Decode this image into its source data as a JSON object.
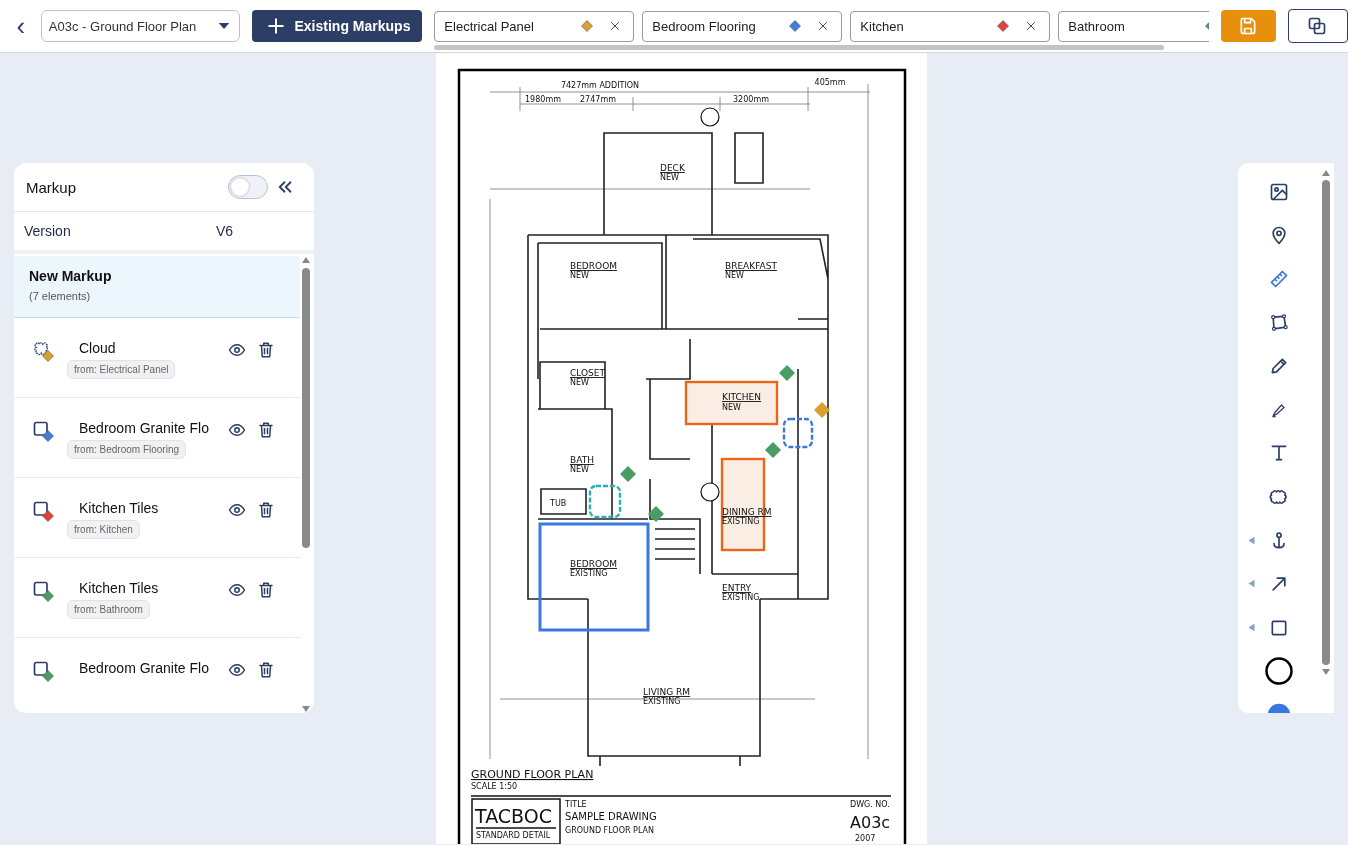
{
  "topbar": {
    "back": "‹",
    "sheet": {
      "value": "A03c - Ground Floor Plan"
    },
    "existing_button": "Existing Markups",
    "tabs": [
      {
        "label": "Electrical Panel",
        "color": "#d9a12b"
      },
      {
        "label": "Bedroom Flooring",
        "color": "#3f7fd6"
      },
      {
        "label": "Kitchen",
        "color": "#e0413a"
      },
      {
        "label": "Bathroom",
        "color": "#4a9d62"
      }
    ]
  },
  "panel": {
    "title": "Markup",
    "toggle": {
      "on": false
    },
    "version_label": "Version",
    "version": "V6",
    "group": {
      "title": "New Markup",
      "count": "(7 elements)",
      "selected": true
    },
    "items": [
      {
        "name": "Cloud",
        "source": "from: Electrical Panel",
        "kind": "cloud",
        "color": "#d9a12b"
      },
      {
        "name": "Bedroom Granite Flo",
        "source": "from: Bedroom Flooring",
        "kind": "rect",
        "color": "#3f7fd6"
      },
      {
        "name": "Kitchen Tiles",
        "source": "from: Kitchen",
        "kind": "rect",
        "color": "#e0413a"
      },
      {
        "name": "Kitchen Tiles",
        "source": "from: Bathroom",
        "kind": "rect",
        "color": "#4a9d62"
      },
      {
        "name": "Bedroom Granite Flo",
        "kind": "rect",
        "color": "#4a9d62"
      }
    ]
  },
  "sheet": {
    "labels": [
      {
        "text": "7427mm  ADDITION",
        "kind": "dim"
      },
      {
        "text": "1980mm",
        "kind": "dim"
      },
      {
        "text": "2747mm",
        "kind": "dim"
      },
      {
        "text": "3200mm",
        "kind": "dim"
      },
      {
        "text": "405mm",
        "kind": "dim"
      },
      {
        "text": "DECK",
        "kind": "room"
      },
      {
        "text": "NEW",
        "kind": "note"
      },
      {
        "text": "BEDROOM",
        "kind": "room"
      },
      {
        "text": "NEW",
        "kind": "note"
      },
      {
        "text": "BREAKFAST",
        "kind": "room"
      },
      {
        "text": "NEW",
        "kind": "note"
      },
      {
        "text": "CLOSET",
        "kind": "room"
      },
      {
        "text": "NEW",
        "kind": "note"
      },
      {
        "text": "KITCHEN",
        "kind": "room"
      },
      {
        "text": "NEW",
        "kind": "note"
      },
      {
        "text": "BATH",
        "kind": "room"
      },
      {
        "text": "NEW",
        "kind": "note"
      },
      {
        "text": "TUB",
        "kind": "note"
      },
      {
        "text": "DINING RM",
        "kind": "room"
      },
      {
        "text": "EXISTING",
        "kind": "note"
      },
      {
        "text": "BEDROOM",
        "kind": "room"
      },
      {
        "text": "EXISTING",
        "kind": "note"
      },
      {
        "text": "ENTRY",
        "kind": "room"
      },
      {
        "text": "EXISTING",
        "kind": "note"
      },
      {
        "text": "LIVING RM",
        "kind": "room"
      },
      {
        "text": "EXISTING",
        "kind": "note"
      },
      {
        "text": "GROUND FLOOR PLAN",
        "kind": "heading"
      },
      {
        "text": "SCALE 1:50",
        "kind": "note"
      },
      {
        "text": "TACBOC",
        "kind": "logo"
      },
      {
        "text": "STANDARD DETAIL",
        "kind": "logosub"
      },
      {
        "text": "TITLE",
        "kind": "note"
      },
      {
        "text": "SAMPLE DRAWING",
        "kind": "title"
      },
      {
        "text": "GROUND FLOOR PLAN",
        "kind": "subtitle"
      },
      {
        "text": "DWG. NO.",
        "kind": "note"
      },
      {
        "text": "A03c",
        "kind": "number"
      },
      {
        "text": "2007",
        "kind": "note"
      }
    ],
    "markups": [
      {
        "kind": "rect",
        "color": "#e8671c",
        "fill": true
      },
      {
        "kind": "rect",
        "color": "#e8671c",
        "fill": true
      },
      {
        "kind": "rect",
        "color": "#3a78e0",
        "fill": false
      },
      {
        "kind": "cloud",
        "color": "#3a78e0",
        "fill": false
      },
      {
        "kind": "cloud",
        "color": "#2ab0b0",
        "fill": false
      },
      {
        "kind": "pin",
        "color": "#4a9d62"
      },
      {
        "kind": "pin",
        "color": "#d9a12b"
      },
      {
        "kind": "pin",
        "color": "#4a9d62"
      },
      {
        "kind": "pin",
        "color": "#4a9d62"
      },
      {
        "kind": "pin",
        "color": "#4a9d62"
      }
    ]
  },
  "tools": [
    {
      "kind": "image",
      "selected": false
    },
    {
      "kind": "pin",
      "selected": false
    },
    {
      "kind": "ruler",
      "selected": true
    },
    {
      "kind": "polygon",
      "selected": false
    },
    {
      "kind": "pencil",
      "selected": false
    },
    {
      "kind": "highlighter",
      "selected": false
    },
    {
      "kind": "text",
      "selected": false
    },
    {
      "kind": "cloud",
      "selected": false
    },
    {
      "kind": "anchor",
      "selected": false,
      "flyout": true
    },
    {
      "kind": "arrow",
      "selected": false,
      "flyout": true
    },
    {
      "kind": "square",
      "selected": false,
      "flyout": true
    },
    {
      "kind": "circle",
      "selected": false
    },
    {
      "kind": "swatch",
      "selected": false
    }
  ]
}
